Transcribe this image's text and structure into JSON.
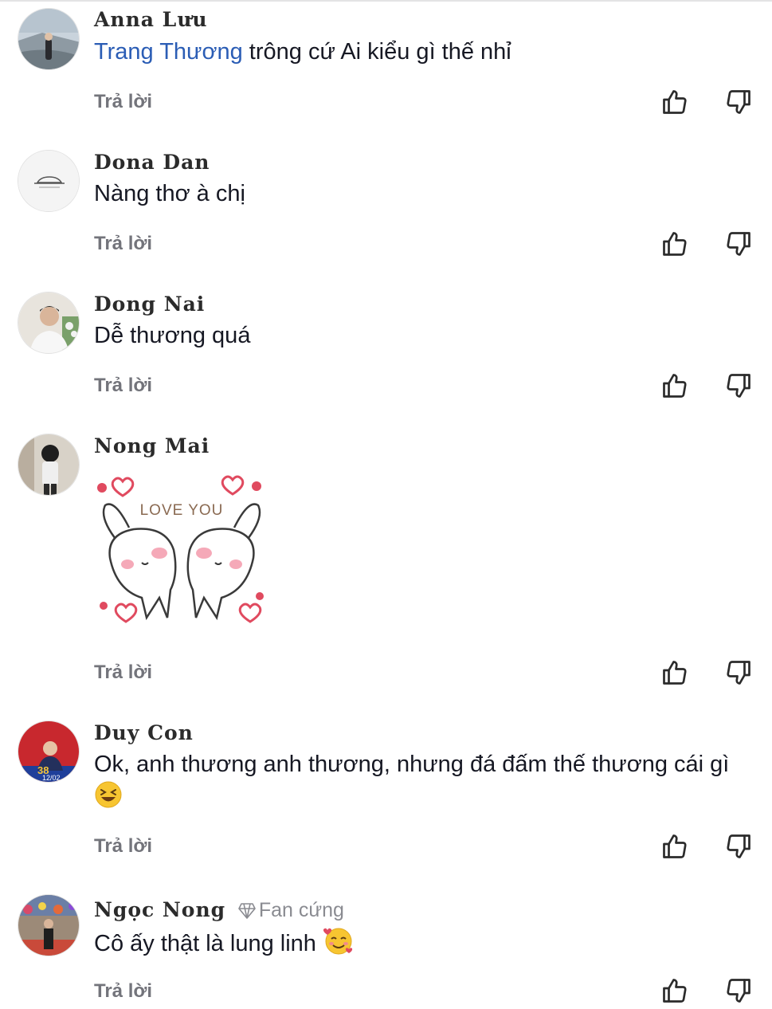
{
  "comments": [
    {
      "username": "Anna Lưu",
      "mention": "Trang Thương",
      "text": " trông cứ Ai kiểu gì thế nhỉ",
      "reply_label": "Trả lời"
    },
    {
      "username": "Dona Dan",
      "text": "Nàng thơ à chị",
      "reply_label": "Trả lời"
    },
    {
      "username": "Dong Nai",
      "text": "Dễ thương quá",
      "reply_label": "Trả lời"
    },
    {
      "username": "Nong Mai",
      "sticker_caption": "LOVE YOU",
      "reply_label": "Trả lời"
    },
    {
      "username": "Duy Con",
      "text": "Ok, anh thương anh thương, nhưng đá đấm thế thương cái gì",
      "avatar_caption": "12/02",
      "reply_label": "Trả lời"
    },
    {
      "username": "Ngọc Nong",
      "badge": "Fan cứng",
      "text": "Cô ấy thật là lung linh",
      "reply_label": "Trả lời"
    }
  ],
  "icons": {
    "like": "thumbs-up-outline",
    "dislike": "thumbs-down-outline",
    "badge": "diamond-icon"
  },
  "colors": {
    "mention": "#2b5db5",
    "reply": "#73747b",
    "text": "#161823",
    "heart": "#e04a5f"
  }
}
